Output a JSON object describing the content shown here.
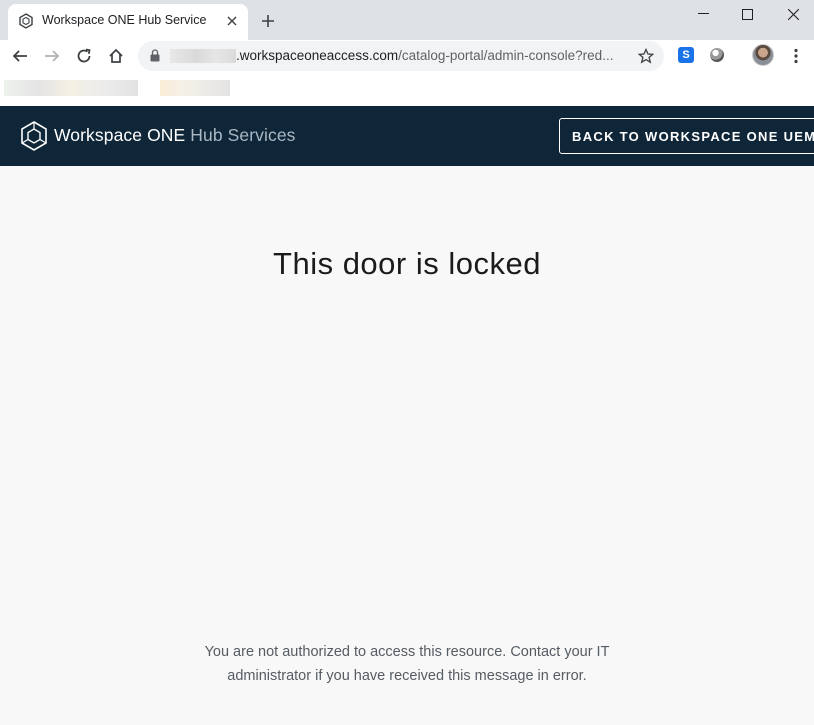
{
  "browser": {
    "tab": {
      "title": "Workspace ONE Hub Service"
    },
    "address": {
      "url_visible": ".workspaceoneaccess.com",
      "url_path": "/catalog-portal/admin-console?red..."
    },
    "extension_label": "S",
    "icons": {
      "favicon": "workspace-one-icon",
      "close": "close-icon",
      "new_tab": "plus-icon",
      "back": "arrow-left-icon",
      "forward": "arrow-right-icon",
      "reload": "reload-icon",
      "home": "home-icon",
      "lock": "lock-icon",
      "bookmark": "star-icon",
      "menu": "kebab-menu-icon"
    }
  },
  "app": {
    "brand_main": "Workspace ONE",
    "brand_sub": "Hub Services",
    "back_button": "BACK TO WORKSPACE ONE UEM",
    "colors": {
      "header_bg": "#0f2638",
      "page_bg": "#f8f8f8"
    }
  },
  "main": {
    "headline": "This door is locked",
    "message": "You are not authorized to access this resource. Contact your IT administrator if you have received this message in error."
  }
}
